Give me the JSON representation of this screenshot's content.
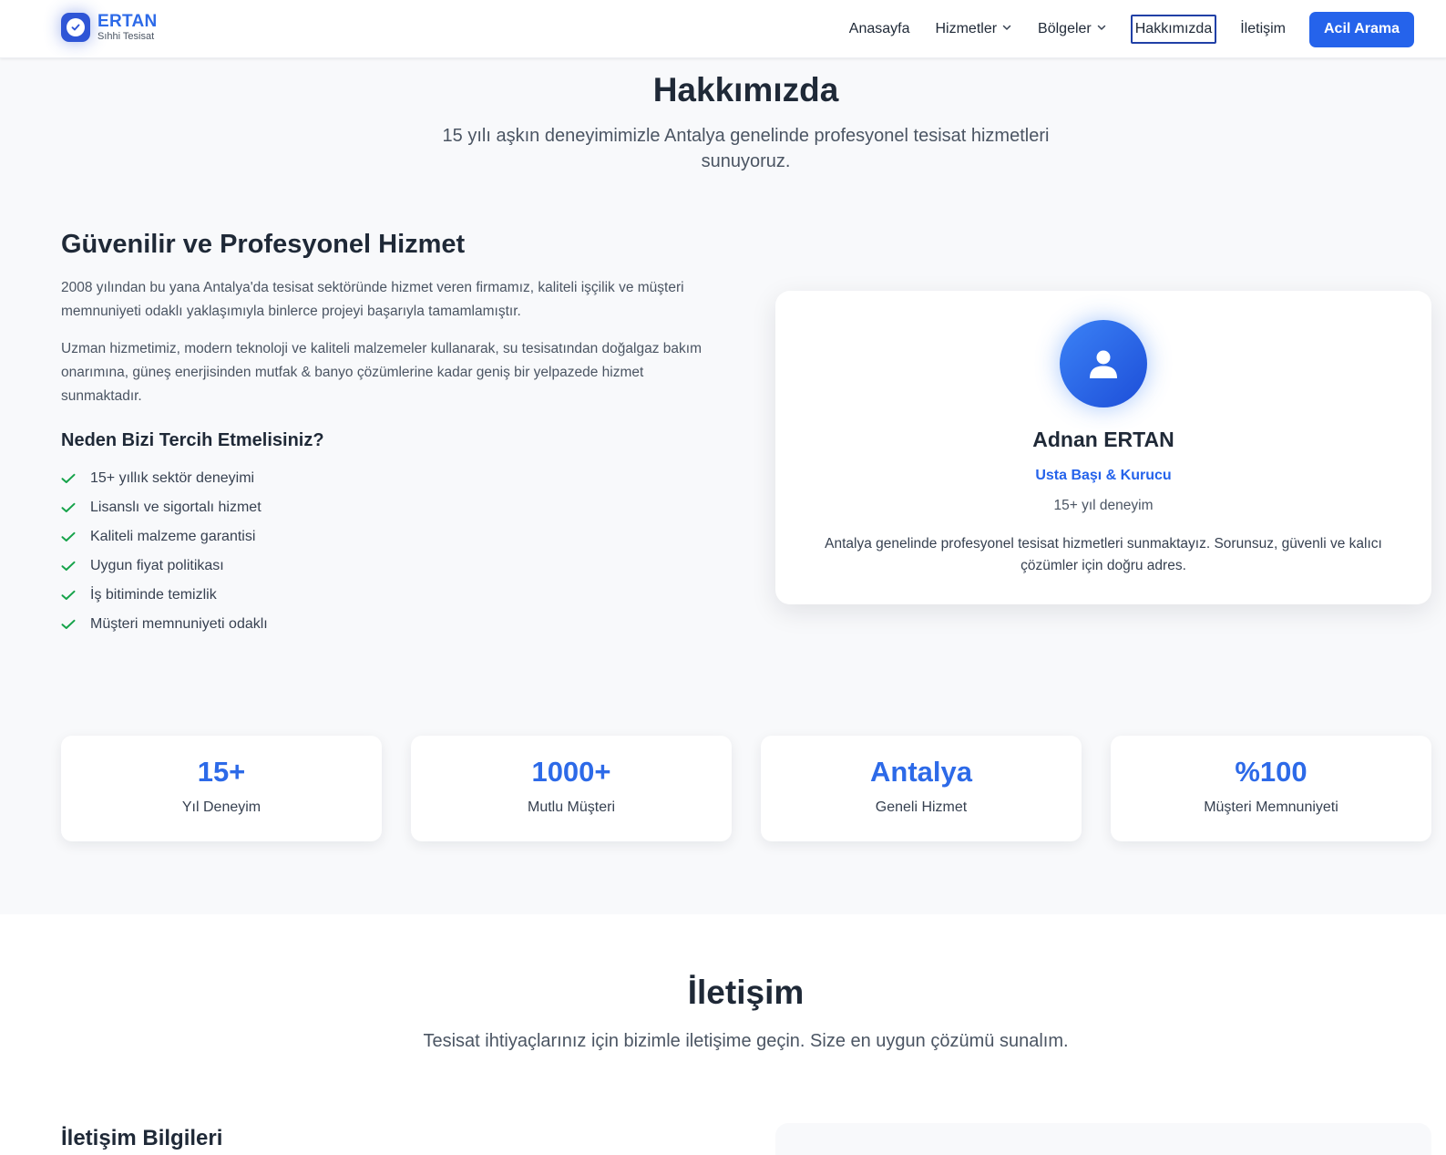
{
  "colors": {
    "accent": "#2563eb",
    "brand": "#2d6ae8",
    "check": "#16a34a"
  },
  "brand": {
    "name": "ERTAN",
    "subtitle": "Sıhhi Tesisat",
    "icon": "check-badge-icon"
  },
  "nav": {
    "items": [
      {
        "label": "Anasayfa",
        "dropdown": false
      },
      {
        "label": "Hizmetler",
        "dropdown": true
      },
      {
        "label": "Bölgeler",
        "dropdown": true
      },
      {
        "label": "Hakkımızda",
        "dropdown": false,
        "active": true
      },
      {
        "label": "İletişim",
        "dropdown": false
      }
    ],
    "cta_label": "Acil Arama"
  },
  "about": {
    "title": "Hakkımızda",
    "subtitle": "15 yılı aşkın deneyimimizle Antalya genelinde profesyonel tesisat hizmetleri sunuyoruz.",
    "heading": "Güvenilir ve Profesyonel Hizmet",
    "paragraphs": [
      "2008 yılından bu yana Antalya'da tesisat sektöründe hizmet veren firmamız, kaliteli işçilik ve müşteri memnuniyeti odaklı yaklaşımıyla binlerce projeyi başarıyla tamamlamıştır.",
      "Uzman hizmetimiz, modern teknoloji ve kaliteli malzemeler kullanarak, su tesisatından doğalgaz bakım onarımına, güneş enerjisinden mutfak & banyo çözümlerine kadar geniş bir yelpazede hizmet sunmaktadır."
    ],
    "why_title": "Neden Bizi Tercih Etmelisiniz?",
    "reasons": [
      "15+ yıllık sektör deneyimi",
      "Lisanslı ve sigortalı hizmet",
      "Kaliteli malzeme garantisi",
      "Uygun fiyat politikası",
      "İş bitiminde temizlik",
      "Müşteri memnuniyeti odaklı"
    ]
  },
  "profile": {
    "icon": "user-icon",
    "name": "Adnan ERTAN",
    "role": "Usta Başı & Kurucu",
    "experience": "15+ yıl deneyim",
    "description": "Antalya genelinde profesyonel tesisat hizmetleri sunmaktayız. Sorunsuz, güvenli ve kalıcı çözümler için doğru adres."
  },
  "stats": [
    {
      "value": "15+",
      "label": "Yıl Deneyim"
    },
    {
      "value": "1000+",
      "label": "Mutlu Müşteri"
    },
    {
      "value": "Antalya",
      "label": "Geneli Hizmet"
    },
    {
      "value": "%100",
      "label": "Müşteri Memnuniyeti"
    }
  ],
  "contact": {
    "title": "İletişim",
    "subtitle": "Tesisat ihtiyaçlarınız için bizimle iletişime geçin. Size en uygun çözümü sunalım.",
    "info_title": "İletişim Bilgileri"
  }
}
